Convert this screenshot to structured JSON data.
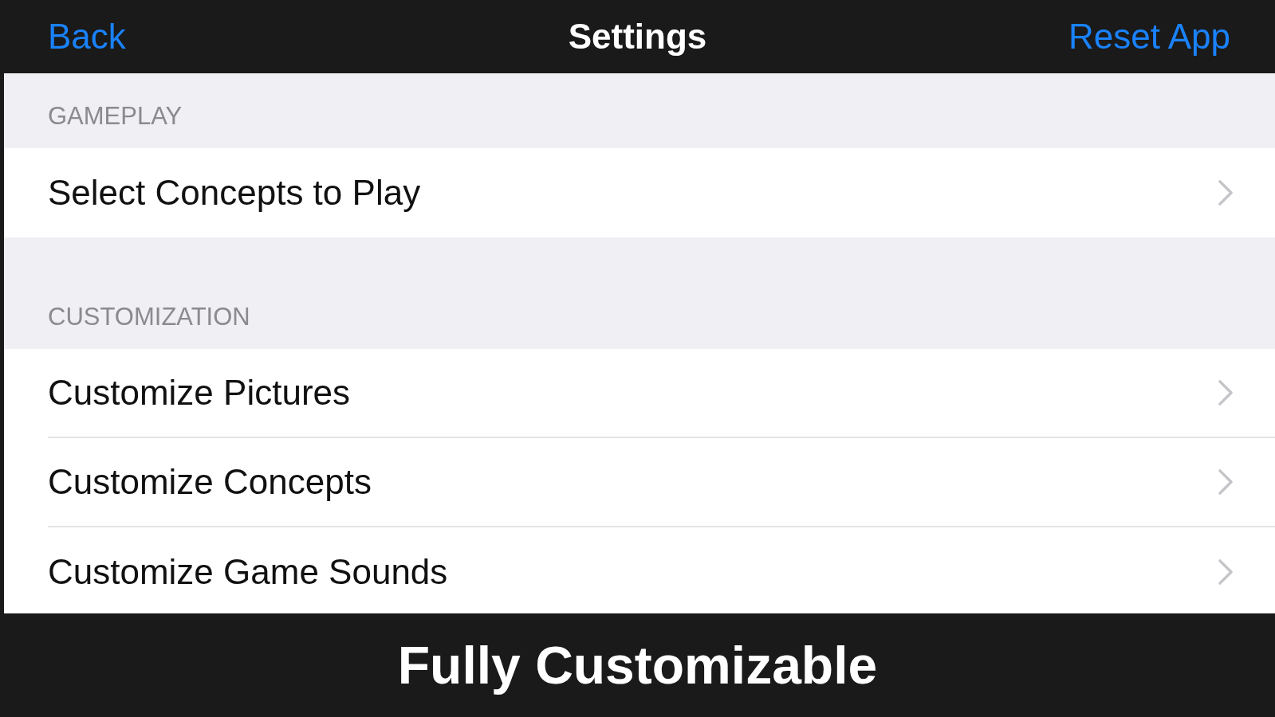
{
  "nav_bar": {
    "back": "Back",
    "title": "Settings",
    "action": "Reset App"
  },
  "sections": [
    {
      "header": "GAMEPLAY",
      "rows": [
        {
          "label": "Select Concepts to Play"
        }
      ]
    },
    {
      "header": "CUSTOMIZATION",
      "rows": [
        {
          "label": "Customize Pictures"
        },
        {
          "label": "Customize Concepts"
        },
        {
          "label": "Customize Game Sounds"
        }
      ]
    }
  ],
  "caption": "Fully Customizable"
}
